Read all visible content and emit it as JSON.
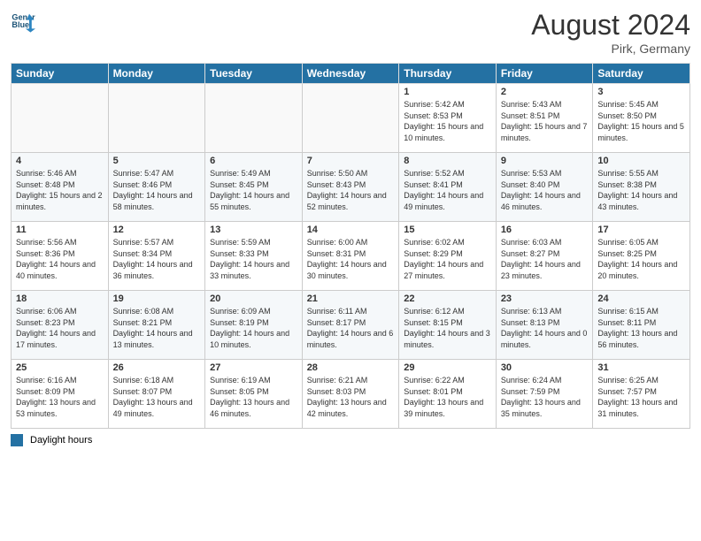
{
  "header": {
    "logo_line1": "General",
    "logo_line2": "Blue",
    "month": "August 2024",
    "location": "Pirk, Germany"
  },
  "days_of_week": [
    "Sunday",
    "Monday",
    "Tuesday",
    "Wednesday",
    "Thursday",
    "Friday",
    "Saturday"
  ],
  "weeks": [
    [
      {
        "day": "",
        "info": ""
      },
      {
        "day": "",
        "info": ""
      },
      {
        "day": "",
        "info": ""
      },
      {
        "day": "",
        "info": ""
      },
      {
        "day": "1",
        "info": "Sunrise: 5:42 AM\nSunset: 8:53 PM\nDaylight: 15 hours\nand 10 minutes."
      },
      {
        "day": "2",
        "info": "Sunrise: 5:43 AM\nSunset: 8:51 PM\nDaylight: 15 hours\nand 7 minutes."
      },
      {
        "day": "3",
        "info": "Sunrise: 5:45 AM\nSunset: 8:50 PM\nDaylight: 15 hours\nand 5 minutes."
      }
    ],
    [
      {
        "day": "4",
        "info": "Sunrise: 5:46 AM\nSunset: 8:48 PM\nDaylight: 15 hours\nand 2 minutes."
      },
      {
        "day": "5",
        "info": "Sunrise: 5:47 AM\nSunset: 8:46 PM\nDaylight: 14 hours\nand 58 minutes."
      },
      {
        "day": "6",
        "info": "Sunrise: 5:49 AM\nSunset: 8:45 PM\nDaylight: 14 hours\nand 55 minutes."
      },
      {
        "day": "7",
        "info": "Sunrise: 5:50 AM\nSunset: 8:43 PM\nDaylight: 14 hours\nand 52 minutes."
      },
      {
        "day": "8",
        "info": "Sunrise: 5:52 AM\nSunset: 8:41 PM\nDaylight: 14 hours\nand 49 minutes."
      },
      {
        "day": "9",
        "info": "Sunrise: 5:53 AM\nSunset: 8:40 PM\nDaylight: 14 hours\nand 46 minutes."
      },
      {
        "day": "10",
        "info": "Sunrise: 5:55 AM\nSunset: 8:38 PM\nDaylight: 14 hours\nand 43 minutes."
      }
    ],
    [
      {
        "day": "11",
        "info": "Sunrise: 5:56 AM\nSunset: 8:36 PM\nDaylight: 14 hours\nand 40 minutes."
      },
      {
        "day": "12",
        "info": "Sunrise: 5:57 AM\nSunset: 8:34 PM\nDaylight: 14 hours\nand 36 minutes."
      },
      {
        "day": "13",
        "info": "Sunrise: 5:59 AM\nSunset: 8:33 PM\nDaylight: 14 hours\nand 33 minutes."
      },
      {
        "day": "14",
        "info": "Sunrise: 6:00 AM\nSunset: 8:31 PM\nDaylight: 14 hours\nand 30 minutes."
      },
      {
        "day": "15",
        "info": "Sunrise: 6:02 AM\nSunset: 8:29 PM\nDaylight: 14 hours\nand 27 minutes."
      },
      {
        "day": "16",
        "info": "Sunrise: 6:03 AM\nSunset: 8:27 PM\nDaylight: 14 hours\nand 23 minutes."
      },
      {
        "day": "17",
        "info": "Sunrise: 6:05 AM\nSunset: 8:25 PM\nDaylight: 14 hours\nand 20 minutes."
      }
    ],
    [
      {
        "day": "18",
        "info": "Sunrise: 6:06 AM\nSunset: 8:23 PM\nDaylight: 14 hours\nand 17 minutes."
      },
      {
        "day": "19",
        "info": "Sunrise: 6:08 AM\nSunset: 8:21 PM\nDaylight: 14 hours\nand 13 minutes."
      },
      {
        "day": "20",
        "info": "Sunrise: 6:09 AM\nSunset: 8:19 PM\nDaylight: 14 hours\nand 10 minutes."
      },
      {
        "day": "21",
        "info": "Sunrise: 6:11 AM\nSunset: 8:17 PM\nDaylight: 14 hours\nand 6 minutes."
      },
      {
        "day": "22",
        "info": "Sunrise: 6:12 AM\nSunset: 8:15 PM\nDaylight: 14 hours\nand 3 minutes."
      },
      {
        "day": "23",
        "info": "Sunrise: 6:13 AM\nSunset: 8:13 PM\nDaylight: 14 hours\nand 0 minutes."
      },
      {
        "day": "24",
        "info": "Sunrise: 6:15 AM\nSunset: 8:11 PM\nDaylight: 13 hours\nand 56 minutes."
      }
    ],
    [
      {
        "day": "25",
        "info": "Sunrise: 6:16 AM\nSunset: 8:09 PM\nDaylight: 13 hours\nand 53 minutes."
      },
      {
        "day": "26",
        "info": "Sunrise: 6:18 AM\nSunset: 8:07 PM\nDaylight: 13 hours\nand 49 minutes."
      },
      {
        "day": "27",
        "info": "Sunrise: 6:19 AM\nSunset: 8:05 PM\nDaylight: 13 hours\nand 46 minutes."
      },
      {
        "day": "28",
        "info": "Sunrise: 6:21 AM\nSunset: 8:03 PM\nDaylight: 13 hours\nand 42 minutes."
      },
      {
        "day": "29",
        "info": "Sunrise: 6:22 AM\nSunset: 8:01 PM\nDaylight: 13 hours\nand 39 minutes."
      },
      {
        "day": "30",
        "info": "Sunrise: 6:24 AM\nSunset: 7:59 PM\nDaylight: 13 hours\nand 35 minutes."
      },
      {
        "day": "31",
        "info": "Sunrise: 6:25 AM\nSunset: 7:57 PM\nDaylight: 13 hours\nand 31 minutes."
      }
    ]
  ],
  "legend": {
    "label": "Daylight hours"
  }
}
